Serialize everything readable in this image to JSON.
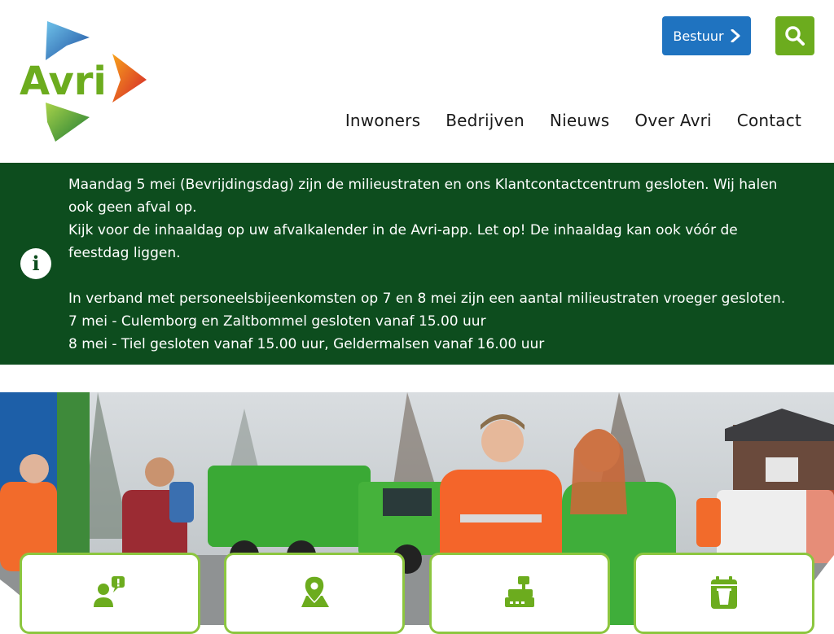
{
  "header": {
    "logo_text": "Avri",
    "bestuur_label": "Bestuur",
    "nav": [
      "Inwoners",
      "Bedrijven",
      "Nieuws",
      "Over Avri",
      "Contact"
    ]
  },
  "notice": {
    "lines": [
      "Maandag 5 mei (Bevrijdingsdag) zijn de milieustraten en ons Klantcontactcentrum gesloten. Wij halen ook geen afval op.",
      "Kijk voor de inhaaldag op uw afvalkalender in de Avri-app. Let op! De inhaaldag kan ook vóór de feestdag liggen.",
      "",
      "In verband met personeelsbijeenkomsten op 7 en 8 mei zijn een aantal milieustraten vroeger gesloten.",
      "7 mei  - Culemborg en Zaltbommel gesloten vanaf 15.00 uur",
      "8 mei - Tiel gesloten vanaf 15.00 uur, Geldermalsen vanaf 16.00 uur"
    ]
  },
  "cards": [
    {
      "icon": "person-message-icon"
    },
    {
      "icon": "map-pin-icon"
    },
    {
      "icon": "cash-register-icon"
    },
    {
      "icon": "calendar-bin-icon"
    }
  ],
  "colors": {
    "brand_green": "#6cac1e",
    "notice_bg": "#0d4d1e",
    "button_blue": "#1f73c0",
    "card_border": "#8cc63f"
  }
}
